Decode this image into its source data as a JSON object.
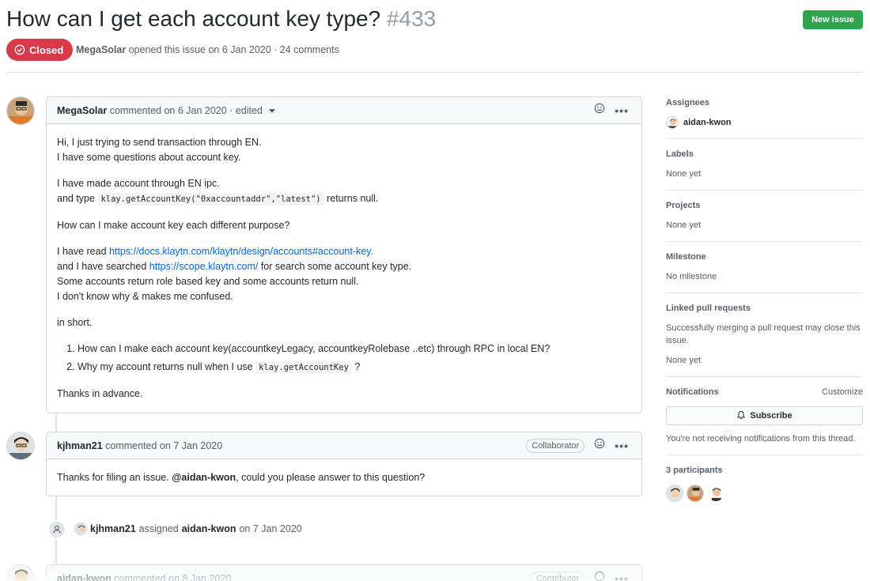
{
  "issue": {
    "title": "How can I get each account key type?",
    "number": "#433",
    "state": "Closed",
    "author": "MegaSolar",
    "opened_text": "opened this issue on 6 Jan 2020 · 24 comments",
    "new_issue_label": "New issue"
  },
  "comments": [
    {
      "author": "MegaSolar",
      "meta": "commented on 6 Jan 2020 · edited",
      "body": {
        "p1_line1": "Hi, I just trying to send transaction through EN.",
        "p1_line2": "I have some questions about account key.",
        "p2_line1": "I have made account through EN ipc.",
        "p2_line2_pre": "and type",
        "p2_code": "klay.getAccountKey(\"0xaccountaddr\",\"latest\")",
        "p2_line2_post": "returns null.",
        "p3": "How can I make account key each different purpose?",
        "p4_line1_pre": "I have read",
        "p4_link1": "https://docs.klaytn.com/klaytn/design/accounts#account-key.",
        "p4_line2_pre": "and I have searched",
        "p4_link2": "https://scope.klaytn.com/",
        "p4_line2_post": "for search some account key type.",
        "p4_line3": "Some accounts return role based key and some accounts return null.",
        "p4_line4": "I don't know why & makes me confused.",
        "p5": "in short.",
        "li1": "How can I make each account key(accountkeyLegacy, accountkeyRolebase ..etc) through RPC in local EN?",
        "li2_pre": "Why my account returns null when I use",
        "li2_code": "klay.getAccountKey",
        "li2_post": "?",
        "p6": "Thanks in advance."
      }
    },
    {
      "author": "kjhman21",
      "meta": "commented on 7 Jan 2020",
      "role": "Collaborator",
      "body_pre": "Thanks for filing an issue.",
      "body_mention": "@aidan-kwon",
      "body_post": ", could you please answer to this question?"
    },
    {
      "author": "aidan-kwon",
      "meta": "commented on 8 Jan 2020",
      "role": "Contributor"
    }
  ],
  "assign_event": {
    "actor": "kjhman21",
    "verb": "assigned",
    "target": "aidan-kwon",
    "date": "on 7 Jan 2020"
  },
  "sidebar": {
    "assignees_heading": "Assignees",
    "assignee": "aidan-kwon",
    "labels_heading": "Labels",
    "labels_value": "None yet",
    "projects_heading": "Projects",
    "projects_value": "None yet",
    "milestone_heading": "Milestone",
    "milestone_value": "No milestone",
    "linked_heading": "Linked pull requests",
    "linked_desc": "Successfully merging a pull request may close this issue.",
    "linked_value": "None yet",
    "notifications_heading": "Notifications",
    "customize_label": "Customize",
    "subscribe_label": "Subscribe",
    "notifications_desc": "You're not receiving notifications from this thread.",
    "participants_heading": "3 participants"
  },
  "colors": {
    "closed": "#d73a49",
    "new_issue": "#2ea44f",
    "link": "#0366d6"
  }
}
